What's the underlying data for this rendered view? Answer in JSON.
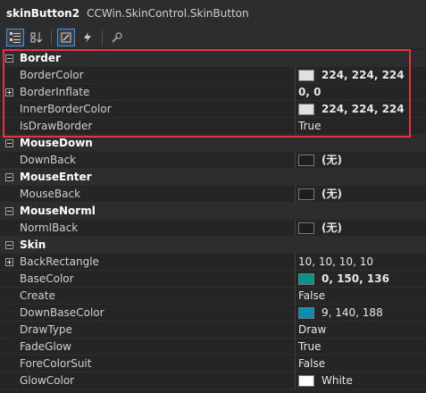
{
  "header": {
    "object_name": "skinButton2",
    "object_type": "CCWin.SkinControl.SkinButton"
  },
  "toolbar": {
    "buttons": [
      "categorized-icon",
      "alphabetical-icon",
      "properties-icon",
      "events-icon",
      "property-pages-icon"
    ]
  },
  "categories": [
    {
      "label": "Border",
      "props": [
        {
          "name": "BorderColor",
          "value": "224, 224, 224",
          "swatch": "#e0e0e0",
          "bold": true
        },
        {
          "name": "BorderInflate",
          "value": "0, 0",
          "bold": true,
          "expandable": true
        },
        {
          "name": "InnerBorderColor",
          "value": "224, 224, 224",
          "swatch": "#e0e0e0",
          "bold": true
        },
        {
          "name": "IsDrawBorder",
          "value": "True"
        }
      ]
    },
    {
      "label": "MouseDown",
      "props": [
        {
          "name": "DownBack",
          "value": "(无)",
          "swatch": "#1e1e1e",
          "bold": true
        }
      ]
    },
    {
      "label": "MouseEnter",
      "props": [
        {
          "name": "MouseBack",
          "value": "(无)",
          "swatch": "#1e1e1e",
          "bold": true
        }
      ]
    },
    {
      "label": "MouseNorml",
      "props": [
        {
          "name": "NormlBack",
          "value": "(无)",
          "swatch": "#1e1e1e",
          "bold": true
        }
      ]
    },
    {
      "label": "Skin",
      "props": [
        {
          "name": "BackRectangle",
          "value": "10, 10, 10, 10",
          "expandable": true
        },
        {
          "name": "BaseColor",
          "value": "0, 150, 136",
          "swatch": "#009688",
          "bold": true
        },
        {
          "name": "Create",
          "value": "False"
        },
        {
          "name": "DownBaseColor",
          "value": "9, 140, 188",
          "swatch": "#098cbc"
        },
        {
          "name": "DrawType",
          "value": "Draw"
        },
        {
          "name": "FadeGlow",
          "value": "True"
        },
        {
          "name": "ForeColorSuit",
          "value": "False"
        },
        {
          "name": "GlowColor",
          "value": "White",
          "swatch": "#ffffff"
        }
      ]
    }
  ],
  "colors": {
    "highlight_box": "#e8323c",
    "active_tool": "#3399ff"
  }
}
